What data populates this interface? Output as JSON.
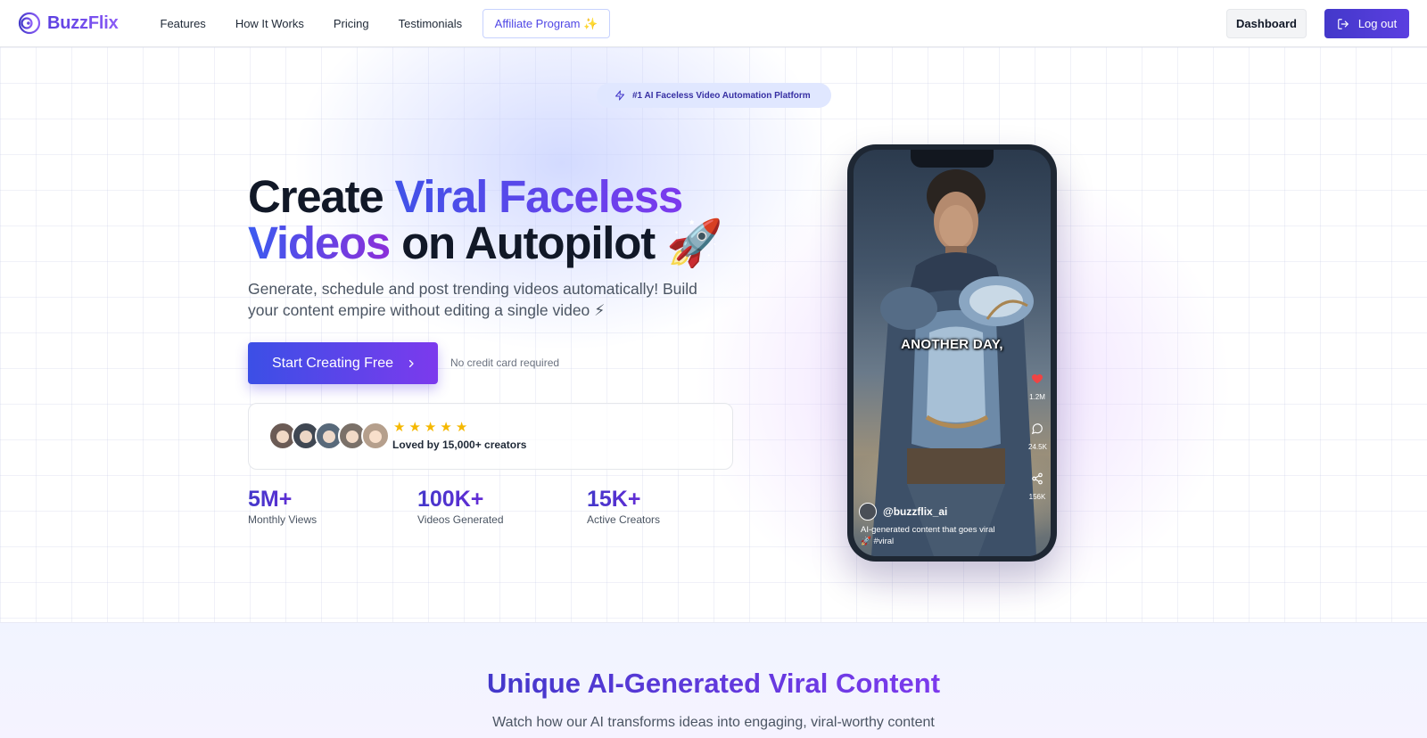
{
  "nav": {
    "brand": "BuzzFlix",
    "links": [
      "Features",
      "How It Works",
      "Pricing",
      "Testimonials"
    ],
    "affiliate": "Affiliate Program ✨",
    "dashboard": "Dashboard",
    "logout": "Log out"
  },
  "hero": {
    "badge": "#1 AI Faceless Video Automation Platform",
    "headline": {
      "part1": "Create ",
      "grad1": "Viral Faceless",
      "grad2": "Videos",
      "part2": " on Autopilot 🚀"
    },
    "subhead": "Generate, schedule and post trending videos automatically! Build your content empire without editing a single video ⚡",
    "cta": "Start Creating Free",
    "no_credit_card": "No credit card required",
    "social_proof": {
      "rating_stars": 5,
      "text": "Loved by 15,000+ creators"
    },
    "stats": [
      {
        "value": "5M+",
        "label": "Monthly Views"
      },
      {
        "value": "100K+",
        "label": "Videos Generated"
      },
      {
        "value": "15K+",
        "label": "Active Creators"
      }
    ]
  },
  "phone": {
    "caption": "ANOTHER DAY,",
    "likes": "1.2M",
    "comments": "24.5K",
    "shares": "156K",
    "handle": "@buzzflix_ai",
    "description": "AI-generated content that goes viral",
    "tags": "🚀 #viral"
  },
  "section2": {
    "title": "Unique AI-Generated Viral Content",
    "subtitle": "Watch how our AI transforms ideas into engaging, viral-worthy content"
  },
  "colors": {
    "brand": "#5b3fe0",
    "accent_purple": "#7c3aed",
    "accent_blue": "#3b4fe6",
    "star": "#f5b800",
    "heart": "#ef4444"
  },
  "icons": [
    "logo-spiral-icon",
    "logout-icon",
    "bolt-icon",
    "chevron-right-icon",
    "star-icon",
    "heart-icon",
    "comment-icon",
    "share-icon"
  ]
}
